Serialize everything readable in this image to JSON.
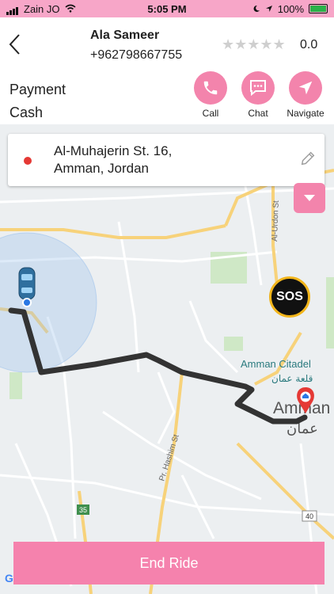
{
  "status_bar": {
    "carrier": "Zain JO",
    "time": "5:05 PM",
    "battery": "100%"
  },
  "driver": {
    "name": "Ala Sameer",
    "phone": "+962798667755",
    "stars": "★★★★★",
    "rating": "0.0"
  },
  "payment": {
    "label": "Payment",
    "value": "Cash"
  },
  "actions": [
    {
      "label": "Call",
      "icon": "phone-icon"
    },
    {
      "label": "Chat",
      "icon": "chat-icon"
    },
    {
      "label": "Navigate",
      "icon": "navigate-icon"
    }
  ],
  "destination": {
    "line1": "Al-Muhajerin St. 16,",
    "line2": "Amman, Jordan"
  },
  "map_labels": {
    "citadel": "Amman Citadel",
    "citadel_ar": "قلعة عمان",
    "city": "Amman",
    "city_ar": "عمان",
    "street_hashim": "Pr. Hashim St",
    "street_urdon": "Al-Urdon St",
    "route_35": "35",
    "route_40": "40",
    "google": "G"
  },
  "sos_label": "SOS",
  "end_ride_label": "End Ride",
  "colors": {
    "accent": "#f384ac",
    "status_bar": "#f7a6c8",
    "route": "#333333"
  }
}
